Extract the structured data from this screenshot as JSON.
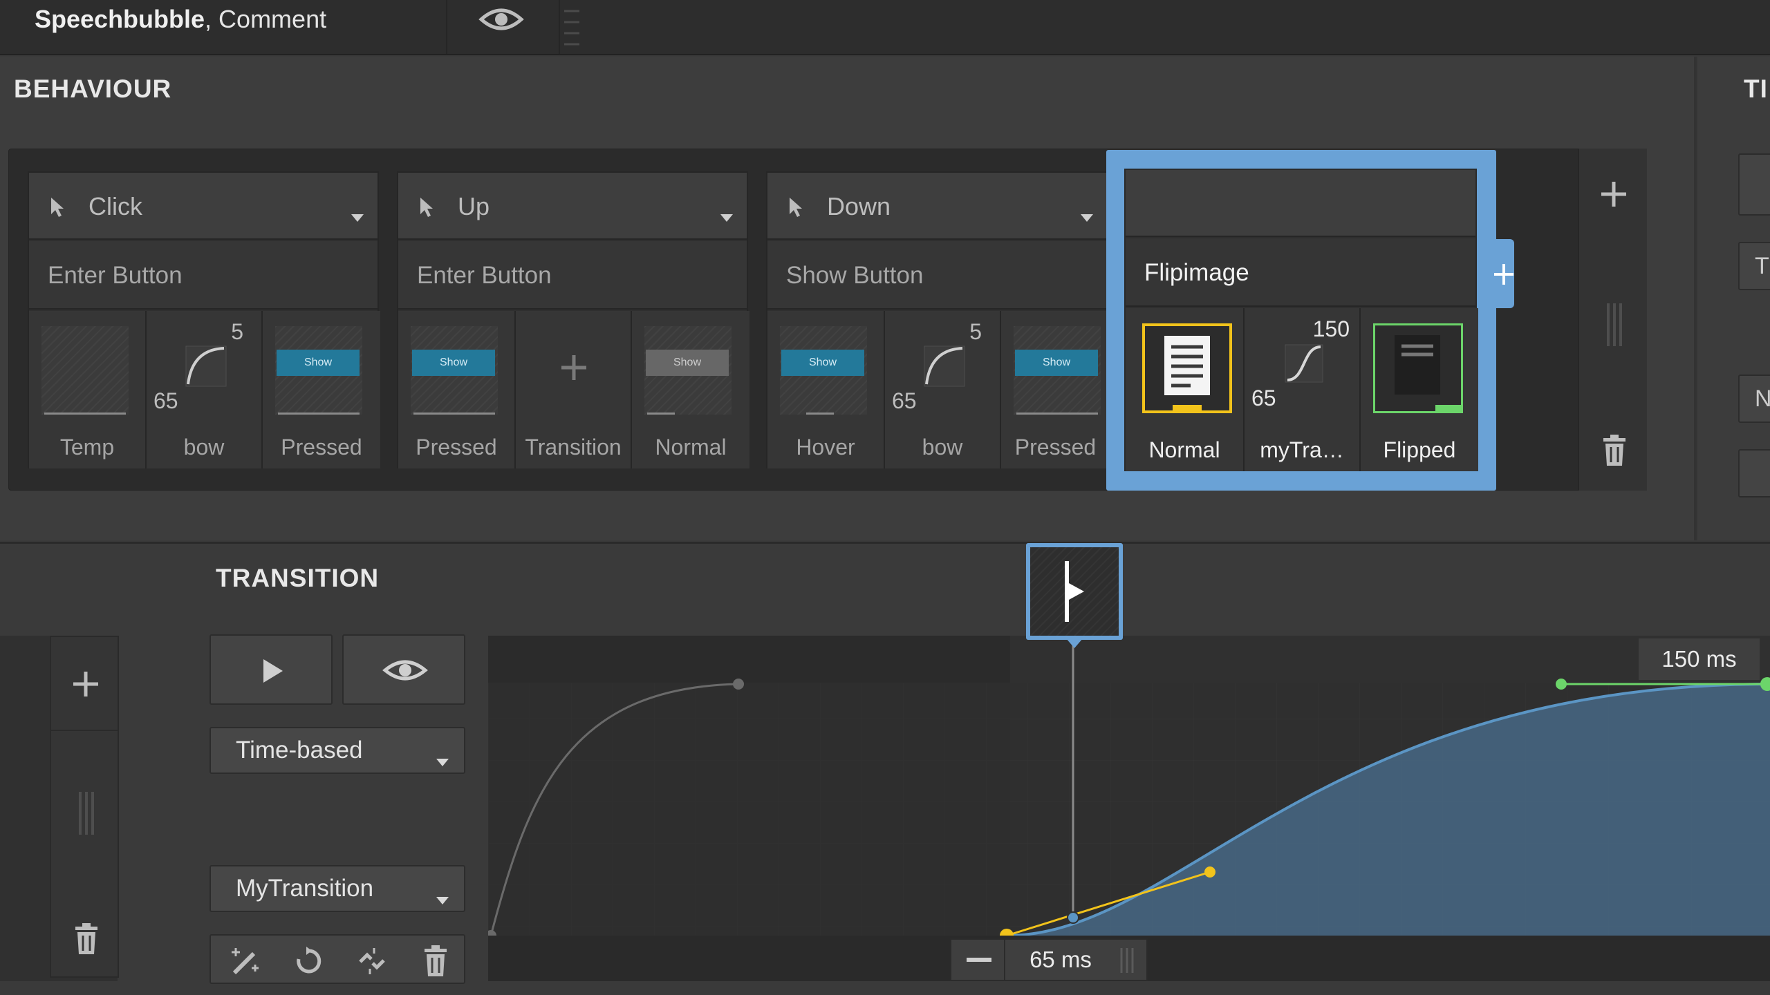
{
  "header": {
    "title_bold": "Speechbubble",
    "title_rest": ", Comment"
  },
  "behaviour": {
    "title": "BEHAVIOUR",
    "right_title_fragment": "TI",
    "cards": [
      {
        "trigger": "Click",
        "action": "Enter Button",
        "slots": [
          {
            "caption": "Temp"
          },
          {
            "caption": "bow",
            "top": "5",
            "bottom": "65"
          },
          {
            "caption": "Pressed",
            "button": "Show"
          }
        ]
      },
      {
        "trigger": "Up",
        "action": "Enter Button",
        "slots": [
          {
            "caption": "Pressed",
            "button": "Show"
          },
          {
            "caption": "Transition"
          },
          {
            "caption": "Normal",
            "button": "Show"
          }
        ]
      },
      {
        "trigger": "Down",
        "action": "Show Button",
        "slots": [
          {
            "caption": "Hover",
            "button": "Show"
          },
          {
            "caption": "bow",
            "top": "5",
            "bottom": "65"
          },
          {
            "caption": "Pressed",
            "button": "Show"
          }
        ]
      },
      {
        "trigger": "",
        "action": "Flipimage",
        "slots": [
          {
            "caption": "Normal"
          },
          {
            "caption": "myTra…",
            "top": "150",
            "bottom": "65"
          },
          {
            "caption": "Flipped"
          }
        ]
      }
    ],
    "right_stub_letters": [
      "T",
      "N"
    ]
  },
  "transition": {
    "title": "TRANSITION",
    "mode_select": "Time-based",
    "transition_select": "MyTransition",
    "end_time_label": "150 ms",
    "current_time_label": "65 ms"
  },
  "colors": {
    "selection_blue": "#6aa2d6",
    "curve_blue": "#5b95c4",
    "handle_yellow": "#f2c31b",
    "handle_green": "#6cd56a",
    "show_button_blue": "#23799a"
  }
}
